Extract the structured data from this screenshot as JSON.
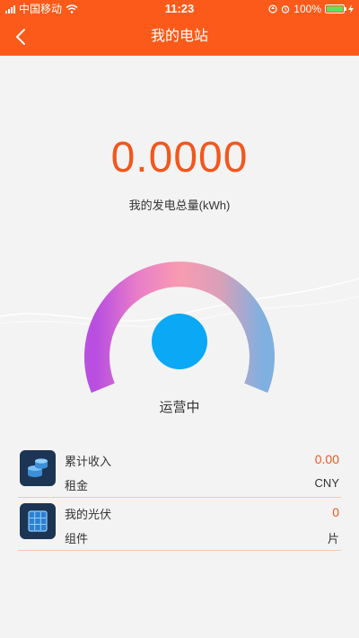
{
  "status_bar": {
    "carrier": "中国移动",
    "time": "11:23",
    "battery": "100%",
    "icons": [
      "signal-icon",
      "wifi-icon",
      "location-icon",
      "alarm-icon",
      "battery-icon",
      "charging-icon"
    ]
  },
  "nav": {
    "title": "我的电站",
    "back_icon": "chevron-left-icon"
  },
  "energy": {
    "total": "0.0000",
    "label": "我的发电总量(kWh)"
  },
  "gauge": {
    "status": "运营中"
  },
  "cards": [
    {
      "icon": "coins-icon",
      "label": "累计收入",
      "sublabel": "租金",
      "value": "0.00",
      "unit": "CNY"
    },
    {
      "icon": "solar-panel-icon",
      "label": "我的光伏",
      "sublabel": "组件",
      "value": "0",
      "unit": "片"
    }
  ],
  "colors": {
    "accent": "#fc5a1a",
    "value": "#f0581f",
    "gauge_start": "#b94fe0",
    "gauge_mid": "#f99bb0",
    "gauge_end": "#7fb0e0",
    "dot": "#0aa8f5",
    "icon_bg": "#1c3554"
  }
}
